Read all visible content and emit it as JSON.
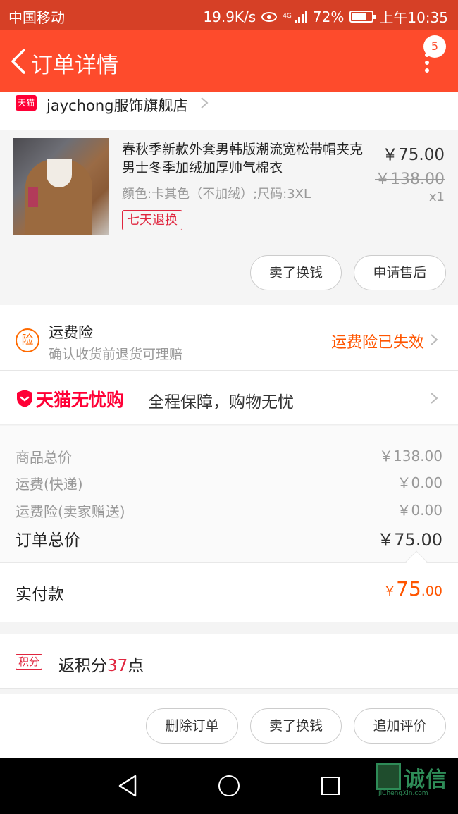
{
  "status_bar": {
    "carrier": "中国移动",
    "speed": "19.9K/s",
    "network": "4G",
    "battery": "72%",
    "battery_level": 0.72,
    "time": "上午10:35"
  },
  "header": {
    "title": "订单详情",
    "badge_count": "5",
    "back_icon": "chevron-left-icon",
    "more_icon": "more-vertical-icon"
  },
  "store": {
    "logo_text": "天猫",
    "name": "jaychong服饰旗舰店"
  },
  "product": {
    "title": "春秋季新款外套男韩版潮流宽松带帽夹克男士冬季加绒加厚帅气棉衣",
    "sku": "颜色:卡其色（不加绒）;尺码:3XL",
    "return_tag": "七天退换",
    "price": "￥75.00",
    "original_price": "￥138.00",
    "quantity": "x1",
    "buttons": {
      "resell": "卖了换钱",
      "after_sale": "申请售后"
    }
  },
  "insurance": {
    "icon_text": "险",
    "title": "运费险",
    "subtitle": "确认收货前退货可理赔",
    "status": "运费险已失效"
  },
  "guarantee": {
    "brand": "天猫无忧购",
    "text": "全程保障，购物无忧"
  },
  "summary": {
    "items": [
      {
        "label": "商品总价",
        "value": "￥138.00"
      },
      {
        "label": "运费(快递)",
        "value": "￥0.00"
      },
      {
        "label": "运费险(卖家赠送)",
        "value": "￥0.00"
      }
    ],
    "total_label": "订单总价",
    "total_value": "￥75.00"
  },
  "paid": {
    "label": "实付款",
    "currency": "￥",
    "integer": "75",
    "decimal": ".00"
  },
  "points": {
    "tag": "积分",
    "prefix": "返积分",
    "number": "37",
    "suffix": "点"
  },
  "actions": {
    "delete": "删除订单",
    "resell": "卖了换钱",
    "review": "追加评价"
  },
  "watermark": {
    "logo_text": "诚信",
    "sub_text": "JiChengXin.com"
  },
  "colors": {
    "header": "#fe4b2c",
    "status_bar": "#d64026",
    "accent_orange": "#ff5500",
    "tmall_red": "#ff0036"
  }
}
